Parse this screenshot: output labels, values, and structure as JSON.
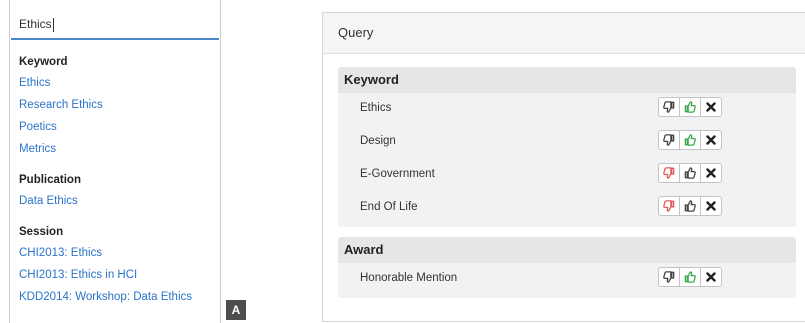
{
  "search": {
    "value": "Ethics"
  },
  "autocomplete": {
    "groups": [
      {
        "title": "Keyword",
        "items": [
          "Ethics",
          "Research Ethics",
          "Poetics",
          "Metrics"
        ]
      },
      {
        "title": "Publication",
        "items": [
          "Data Ethics"
        ]
      },
      {
        "title": "Session",
        "items": [
          "CHI2013: Ethics",
          "CHI2013: Ethics in HCI",
          "KDD2014: Workshop: Data Ethics"
        ]
      }
    ],
    "corner_label": "A"
  },
  "query": {
    "title": "Query",
    "sections": [
      {
        "title": "Keyword",
        "rows": [
          {
            "label": "Ethics",
            "vote": "up"
          },
          {
            "label": "Design",
            "vote": "up"
          },
          {
            "label": "E-Government",
            "vote": "down"
          },
          {
            "label": "End Of Life",
            "vote": "down"
          }
        ]
      },
      {
        "title": "Award",
        "rows": [
          {
            "label": "Honorable Mention",
            "vote": "up"
          }
        ]
      }
    ]
  },
  "colors": {
    "link": "#2a74c9",
    "accent_border": "#4a86c8",
    "thumb_up_active": "#3aa84a",
    "thumb_down_active": "#e25a5a",
    "thumb_neutral": "#444444",
    "remove": "#222222"
  },
  "icons": [
    "thumbs-down-icon",
    "thumbs-up-icon",
    "remove-icon"
  ]
}
